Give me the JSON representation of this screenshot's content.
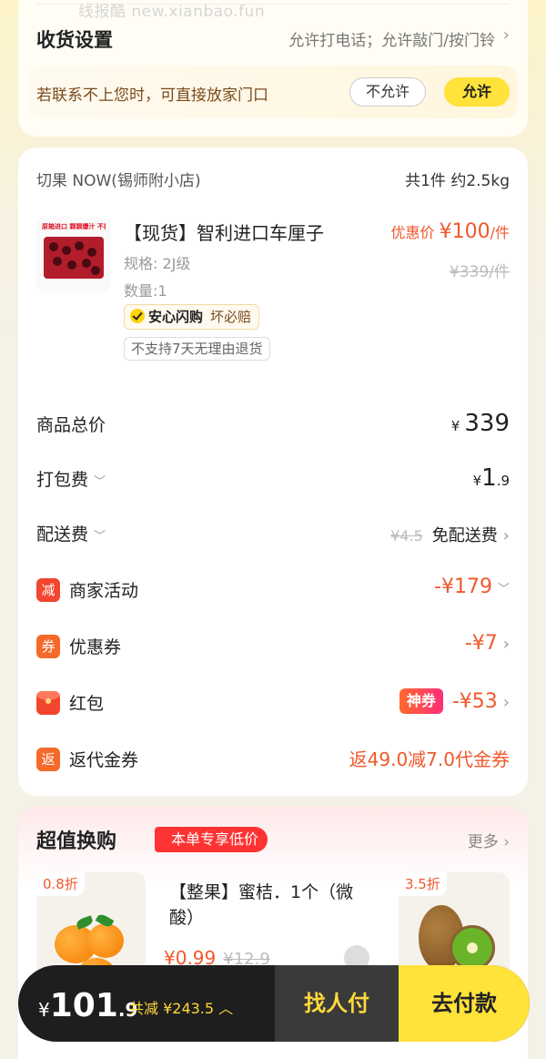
{
  "watermark": "线报酷 new.xianbao.fun",
  "delivery": {
    "title": "收货设置",
    "value": "允许打电话；允许敲门/按门铃",
    "notice": "若联系不上您时，可直接放家门口",
    "deny_label": "不允许",
    "allow_label": "允许"
  },
  "shop": {
    "name": "切果 NOW(锡师附小店)",
    "summary": "共1件 约2.5kg"
  },
  "product": {
    "image_caption": "原箱进口 颗颗爆汁 不拆箱 更保鲜",
    "title": "【现货】智利进口车厘子",
    "spec": "规格: 2J级",
    "qty": "数量:1",
    "promo_label": "优惠价",
    "promo_price": "¥100",
    "promo_unit": "/件",
    "orig_price": "¥339/件",
    "tag_safe": "安心闪购",
    "tag_safe_sub": "坏必赔",
    "tag_return": "不支持7天无理由退货"
  },
  "fees": {
    "goods_total_label": "商品总价",
    "goods_total_yen": "¥",
    "goods_total_value": "339",
    "packing_label": "打包费",
    "packing_yen": "¥",
    "packing_int": "1",
    "packing_dec": ".9",
    "delivery_label": "配送费",
    "delivery_orig": "¥4.5",
    "delivery_value": "免配送费",
    "merchant_icon": "减",
    "merchant_label": "商家活动",
    "merchant_value": "-¥179",
    "coupon_icon": "券",
    "coupon_label": "优惠券",
    "coupon_value": "-¥7",
    "redpack_label": "红包",
    "redpack_badge": "神券",
    "redpack_value": "-¥53",
    "voucher_icon": "返",
    "voucher_label": "返代金券",
    "voucher_value": "返49.0减7.0代金券"
  },
  "exchange": {
    "title": "超值换购",
    "badge": "本单专享低价",
    "more": "更多",
    "item1_discount": "0.8折",
    "item2_title": "【整果】蜜桔．1个（微酸）",
    "item2_price": "¥0.99",
    "item2_orig": "¥12.9",
    "item3_discount": "3.5折"
  },
  "bottom": {
    "yen": "¥",
    "total_int": "101",
    "total_dec": ".9",
    "saved": "共减 ¥243.5",
    "share_label": "找人付",
    "pay_label": "去付款"
  },
  "colors": {
    "accent_yellow": "#ffe23a",
    "price_red": "#f0582b",
    "dark_bar": "#1e1e1e"
  }
}
